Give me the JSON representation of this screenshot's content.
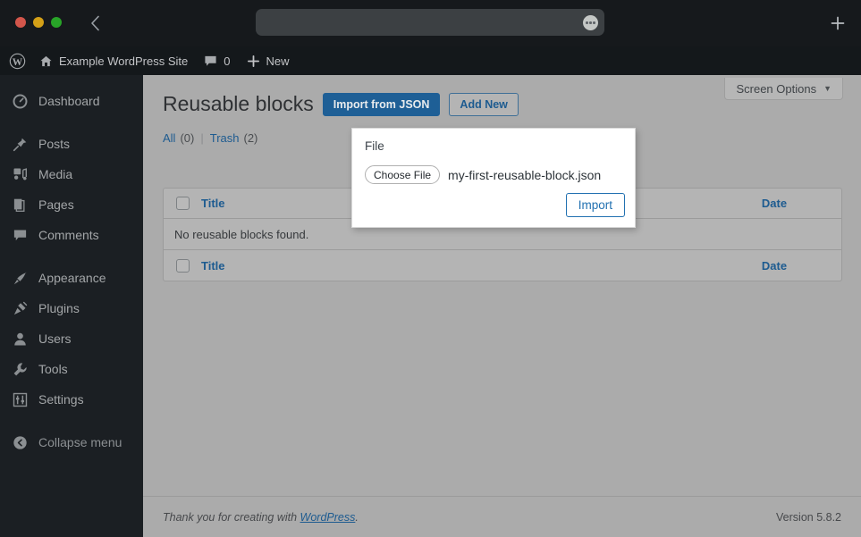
{
  "browser": {
    "traffic_lights": [
      "close",
      "minimize",
      "maximize"
    ],
    "back_label": "Back",
    "url_value": "",
    "url_placeholder": "",
    "menu_dots_label": "...",
    "new_tab_label": "+",
    "colors": {
      "chrome_bg": "#16191c",
      "url_bar_bg": "#3c4043",
      "red": "#d3564b",
      "yellow": "#d4a017",
      "green": "#28a428"
    }
  },
  "adminbar": {
    "logo_icon": "wordpress-logo-icon",
    "site_icon": "home-icon",
    "site_name": "Example WordPress Site",
    "comments_icon": "comment-bubble-icon",
    "comments_count": "0",
    "new_icon": "plus-icon",
    "new_label": "New"
  },
  "sidebar": {
    "items": [
      {
        "label": "Dashboard",
        "icon": "dashboard-icon"
      },
      {
        "label": "Posts",
        "icon": "pin-icon"
      },
      {
        "label": "Media",
        "icon": "media-icon"
      },
      {
        "label": "Pages",
        "icon": "page-icon"
      },
      {
        "label": "Comments",
        "icon": "comment-icon"
      },
      {
        "label": "Appearance",
        "icon": "paintbrush-icon"
      },
      {
        "label": "Plugins",
        "icon": "plug-icon"
      },
      {
        "label": "Users",
        "icon": "user-icon"
      },
      {
        "label": "Tools",
        "icon": "wrench-icon"
      },
      {
        "label": "Settings",
        "icon": "sliders-icon"
      }
    ],
    "collapse_label": "Collapse menu",
    "collapse_icon": "chevron-left-circle-icon"
  },
  "main": {
    "screen_options_label": "Screen Options",
    "screen_options_caret": "▼",
    "page_title": "Reusable blocks",
    "import_button_label": "Import from JSON",
    "add_new_button_label": "Add New",
    "filters": {
      "all_label": "All",
      "all_count": "(0)",
      "separator": "|",
      "trash_label": "Trash",
      "trash_count": "(2)"
    },
    "table": {
      "col_title": "Title",
      "col_date": "Date",
      "empty_message": "No reusable blocks found."
    }
  },
  "dialog": {
    "file_label": "File",
    "choose_file_label": "Choose File",
    "file_name": "my-first-reusable-block.json",
    "import_label": "Import"
  },
  "footer": {
    "thanks_prefix": "Thank you for creating with ",
    "wordpress_link": "WordPress",
    "thanks_suffix": ".",
    "version": "Version 5.8.2"
  }
}
